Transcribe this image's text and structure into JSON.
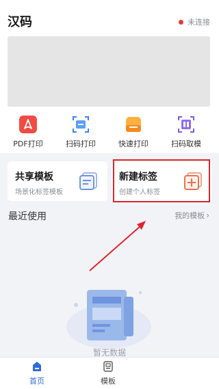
{
  "app": {
    "title": "汉码"
  },
  "connection": {
    "status": "未连接",
    "dot_color": "#e53935"
  },
  "quick_actions": [
    {
      "label": "PDF打印",
      "icon": "pdf-icon"
    },
    {
      "label": "扫码打印",
      "icon": "scan-print-icon"
    },
    {
      "label": "快速打印",
      "icon": "printer-icon"
    },
    {
      "label": "扫码取模",
      "icon": "scan-template-icon"
    }
  ],
  "cards": {
    "shared": {
      "title": "共享模板",
      "subtitle": "场景化标签模板",
      "icon": "template-stack-icon"
    },
    "new_label": {
      "title": "新建标签",
      "subtitle": "创建个人标签",
      "icon": "add-label-icon"
    }
  },
  "recent": {
    "title": "最近使用",
    "my_templates": "我的模板"
  },
  "empty_state": {
    "text": "暂无数据"
  },
  "bottom_nav": [
    {
      "label": "首页",
      "icon": "home-icon",
      "active": true
    },
    {
      "label": "模板",
      "icon": "template-icon",
      "active": false
    }
  ],
  "colors": {
    "accent": "#2f6ad9",
    "highlight": "#e0242b",
    "background": "#f2f3f7"
  }
}
